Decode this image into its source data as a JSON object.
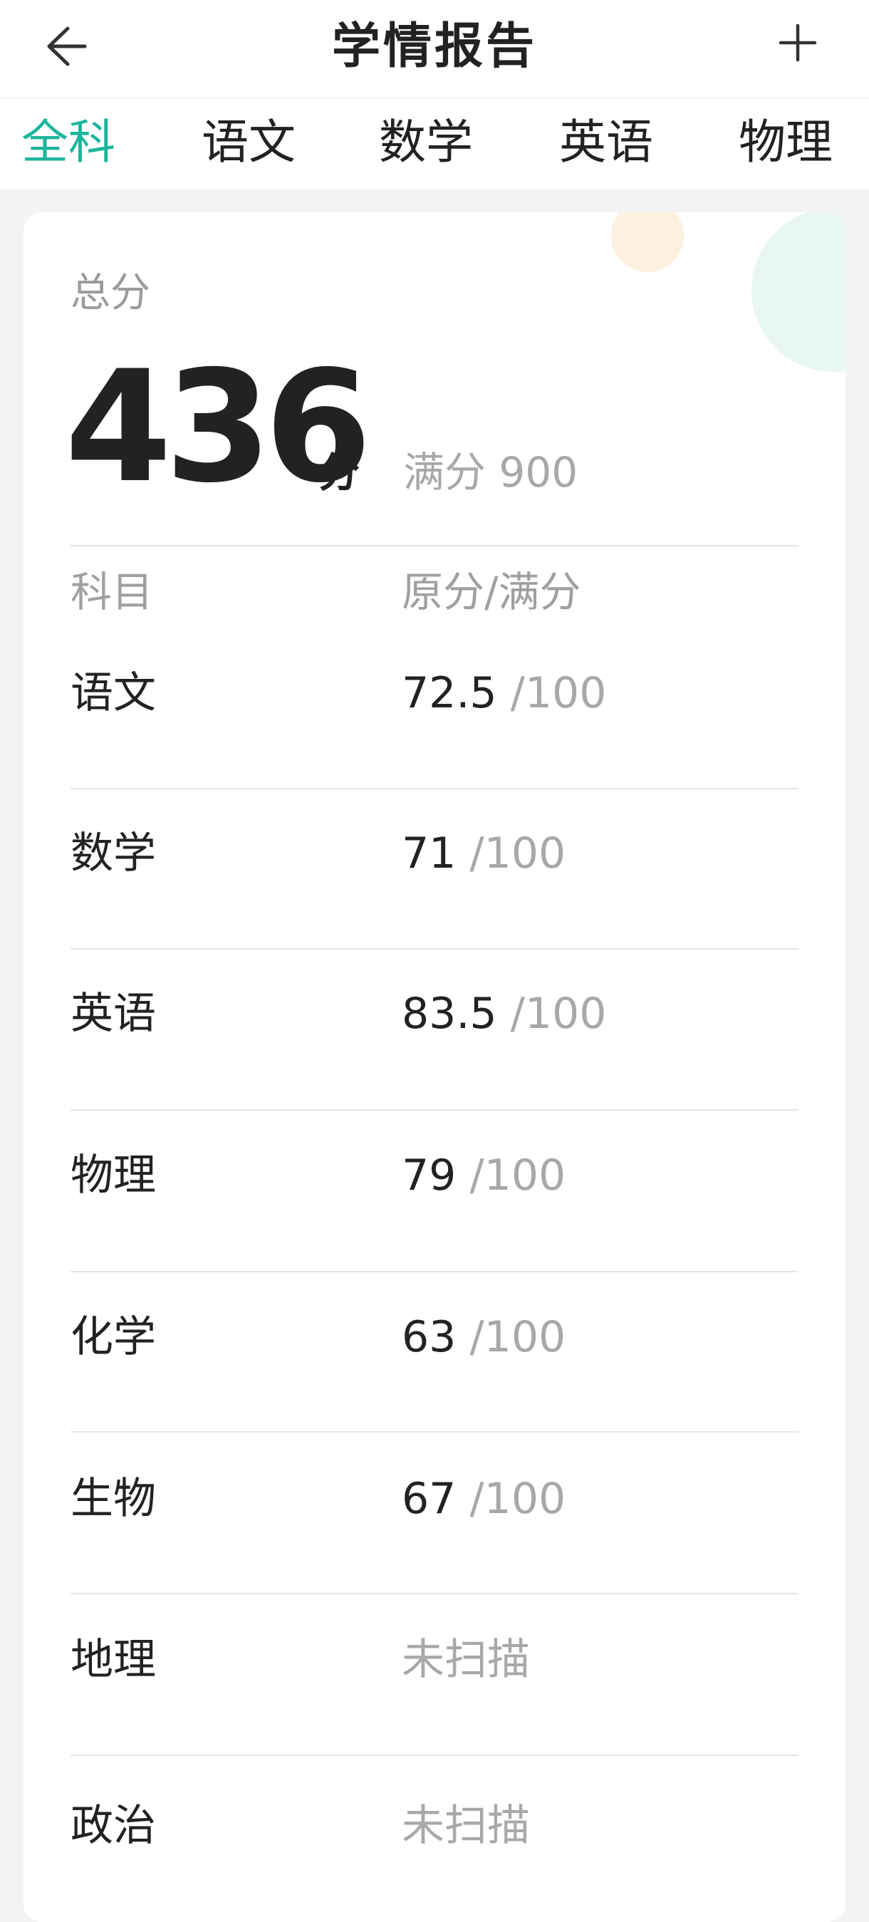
{
  "header": {
    "title": "学情报告",
    "back_icon": "arrow-left-icon",
    "add_icon": "plus-icon"
  },
  "tabs": [
    {
      "label": "全科",
      "active": true
    },
    {
      "label": "语文",
      "active": false
    },
    {
      "label": "数学",
      "active": false
    },
    {
      "label": "英语",
      "active": false
    },
    {
      "label": "物理",
      "active": false
    }
  ],
  "summary": {
    "total_label": "总分",
    "total_value": "436",
    "total_unit": "分",
    "full_score": "满分 900"
  },
  "table": {
    "headers": {
      "subject": "科目",
      "score": "原分/满分"
    },
    "rows": [
      {
        "subject": "语文",
        "score": "72.5",
        "max": " /100"
      },
      {
        "subject": "数学",
        "score": "71",
        "max": " /100"
      },
      {
        "subject": "英语",
        "score": "83.5",
        "max": " /100"
      },
      {
        "subject": "物理",
        "score": "79",
        "max": " /100"
      },
      {
        "subject": "化学",
        "score": "63",
        "max": " /100"
      },
      {
        "subject": "生物",
        "score": "67",
        "max": " /100"
      },
      {
        "subject": "地理",
        "status": "未扫描"
      },
      {
        "subject": "政治",
        "status": "未扫描"
      }
    ]
  },
  "colors": {
    "accent": "#1cb59c",
    "text": "#222222",
    "muted": "#a8a8a8",
    "background": "#f2f3f5"
  }
}
